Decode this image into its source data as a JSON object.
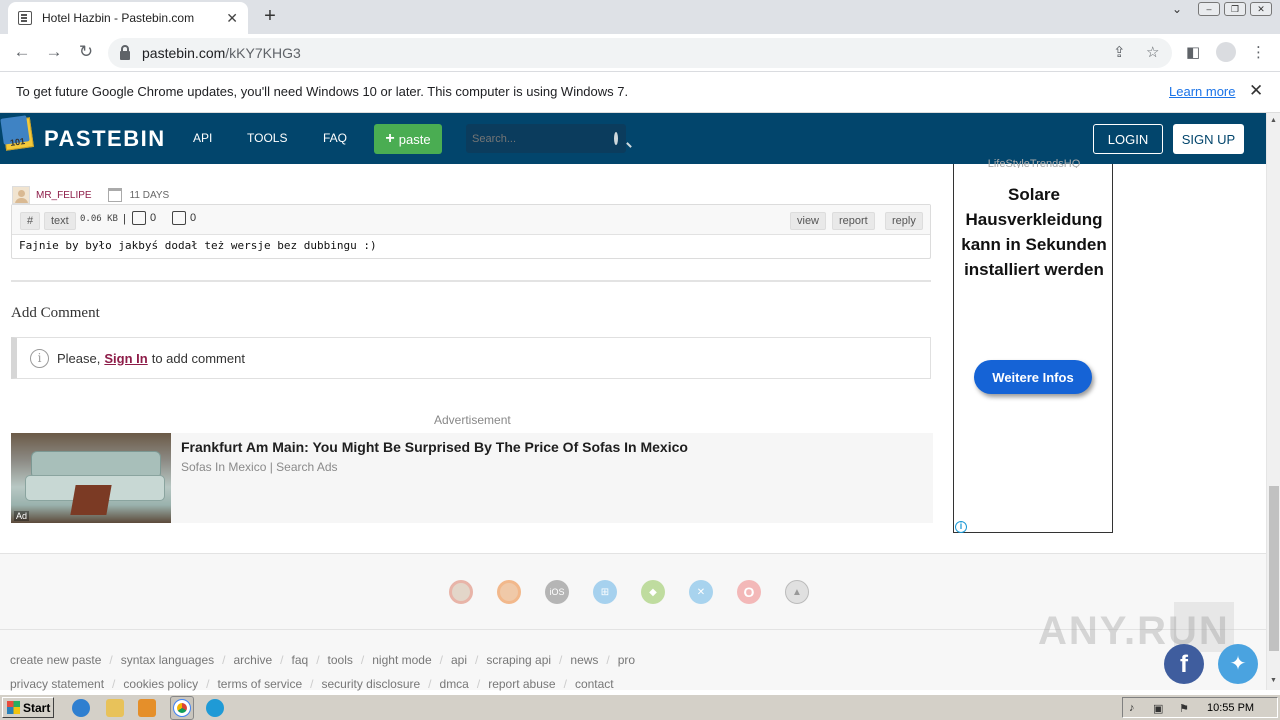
{
  "browser": {
    "tab_title": "Hotel Hazbin - Pastebin.com",
    "url_host": "pastebin.com",
    "url_path": "/kKY7KHG3"
  },
  "infobar": {
    "message": "To get future Google Chrome updates, you'll need Windows 10 or later. This computer is using Windows 7.",
    "learn_more": "Learn more"
  },
  "header": {
    "brand": "PASTEBIN",
    "logo_badge": "101",
    "nav": [
      "API",
      "TOOLS",
      "FAQ"
    ],
    "paste_label": "paste",
    "search_placeholder": "Search...",
    "login": "LOGIN",
    "signup": "SIGN UP"
  },
  "comment": {
    "user": "MR_FELIPE",
    "age": "11 DAYS",
    "hash": "#",
    "format": "text",
    "size": "0.06 KB",
    "likes": "0",
    "dislikes": "0",
    "actions": [
      "view",
      "report",
      "reply"
    ],
    "body": "Fajnie by było jakbyś dodał też wersje bez dubbingu :)"
  },
  "add_comment": {
    "heading": "Add Comment",
    "pre": "Please,",
    "link": "Sign In",
    "post": "to add comment"
  },
  "ad": {
    "label": "Advertisement",
    "badge": "Ad",
    "title": "Frankfurt Am Main: You Might Be Surprised By The Price Of Sofas In Mexico",
    "source": "Sofas In Mexico | Search Ads"
  },
  "side_ad": {
    "brand": "LifeStyleTrendsHQ",
    "headline": "Solare Hausverkleidung kann in Sekunden installiert werden",
    "cta": "Weitere Infos"
  },
  "footer": {
    "os_icons": [
      "chrome-icon",
      "firefox-icon",
      "ios-icon",
      "windows-icon",
      "android-icon",
      "mac-icon",
      "opera-icon",
      "linux-icon"
    ],
    "os_ios_label": "iOS",
    "links_row1": [
      "create new paste",
      "syntax languages",
      "archive",
      "faq",
      "tools",
      "night mode",
      "api",
      "scraping api",
      "news",
      "pro"
    ],
    "links_row2": [
      "privacy statement",
      "cookies policy",
      "terms of service",
      "security disclosure",
      "dmca",
      "report abuse",
      "contact"
    ],
    "watermark": "ANY.RUN"
  },
  "taskbar": {
    "start": "Start",
    "clock": "10:55 PM"
  }
}
